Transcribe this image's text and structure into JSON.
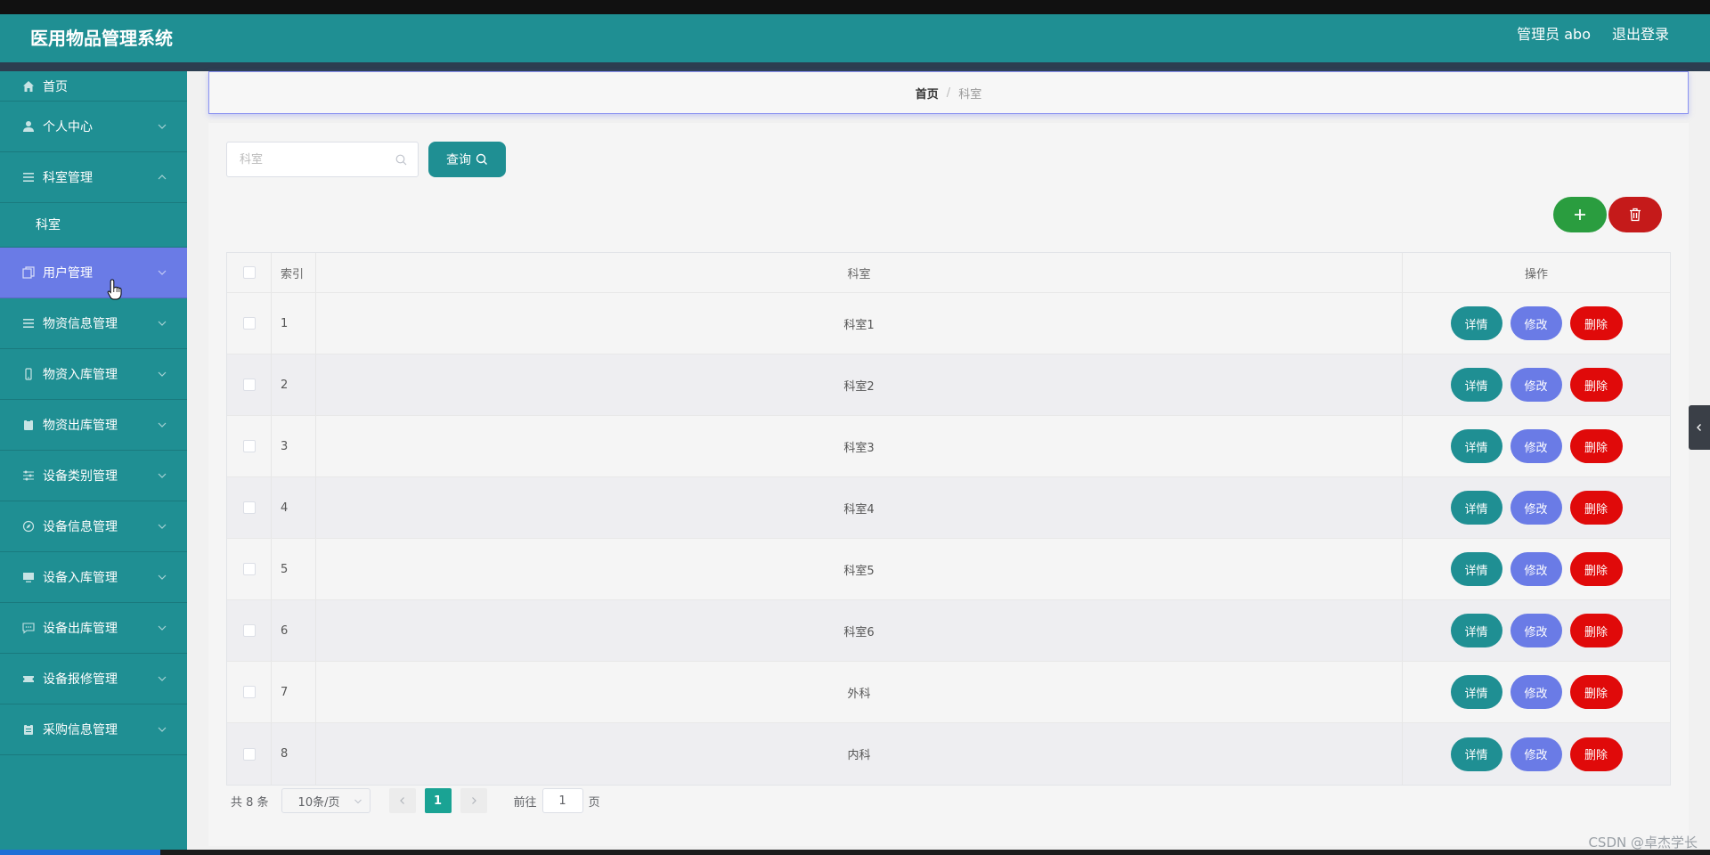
{
  "header": {
    "app_title": "医用物品管理系统",
    "user_label": "管理员 abo",
    "logout_label": "退出登录"
  },
  "sidebar": {
    "items": [
      {
        "label": "首页",
        "icon": "home-icon"
      },
      {
        "label": "个人中心",
        "icon": "user-icon"
      },
      {
        "label": "科室管理",
        "icon": "list-icon",
        "expanded": true,
        "children": [
          {
            "label": "科室"
          }
        ]
      },
      {
        "label": "用户管理",
        "icon": "copy-icon",
        "active": true
      },
      {
        "label": "物资信息管理",
        "icon": "list-icon"
      },
      {
        "label": "物资入库管理",
        "icon": "phone-icon"
      },
      {
        "label": "物资出库管理",
        "icon": "clipboard-icon"
      },
      {
        "label": "设备类别管理",
        "icon": "sliders-icon"
      },
      {
        "label": "设备信息管理",
        "icon": "compass-icon"
      },
      {
        "label": "设备入库管理",
        "icon": "monitor-icon"
      },
      {
        "label": "设备出库管理",
        "icon": "chat-icon"
      },
      {
        "label": "设备报修管理",
        "icon": "ticket-icon"
      },
      {
        "label": "采购信息管理",
        "icon": "clipboard-icon"
      }
    ]
  },
  "breadcrumb": {
    "home": "首页",
    "separator": "/",
    "current": "科室"
  },
  "search": {
    "placeholder": "科室",
    "value": "",
    "query_label": "查询"
  },
  "table": {
    "columns": {
      "index": "索引",
      "name": "科室",
      "actions": "操作"
    },
    "rows": [
      {
        "index": "1",
        "name": "科室1"
      },
      {
        "index": "2",
        "name": "科室2"
      },
      {
        "index": "3",
        "name": "科室3"
      },
      {
        "index": "4",
        "name": "科室4"
      },
      {
        "index": "5",
        "name": "科室5"
      },
      {
        "index": "6",
        "name": "科室6"
      },
      {
        "index": "7",
        "name": "外科"
      },
      {
        "index": "8",
        "name": "内科"
      }
    ],
    "action_labels": {
      "detail": "详情",
      "edit": "修改",
      "delete": "删除"
    }
  },
  "pagination": {
    "total_text": "共 8 条",
    "page_size": "10条/页",
    "current_page": "1",
    "goto_label": "前往",
    "goto_value": "1",
    "page_unit": "页"
  },
  "watermark": "CSDN @卓杰学长",
  "video_progress": 0.094,
  "colors": {
    "primary": "#1f8f93",
    "active_menu": "#6a7be6",
    "add": "#2a9d3f",
    "delete": "#e00a0a"
  }
}
